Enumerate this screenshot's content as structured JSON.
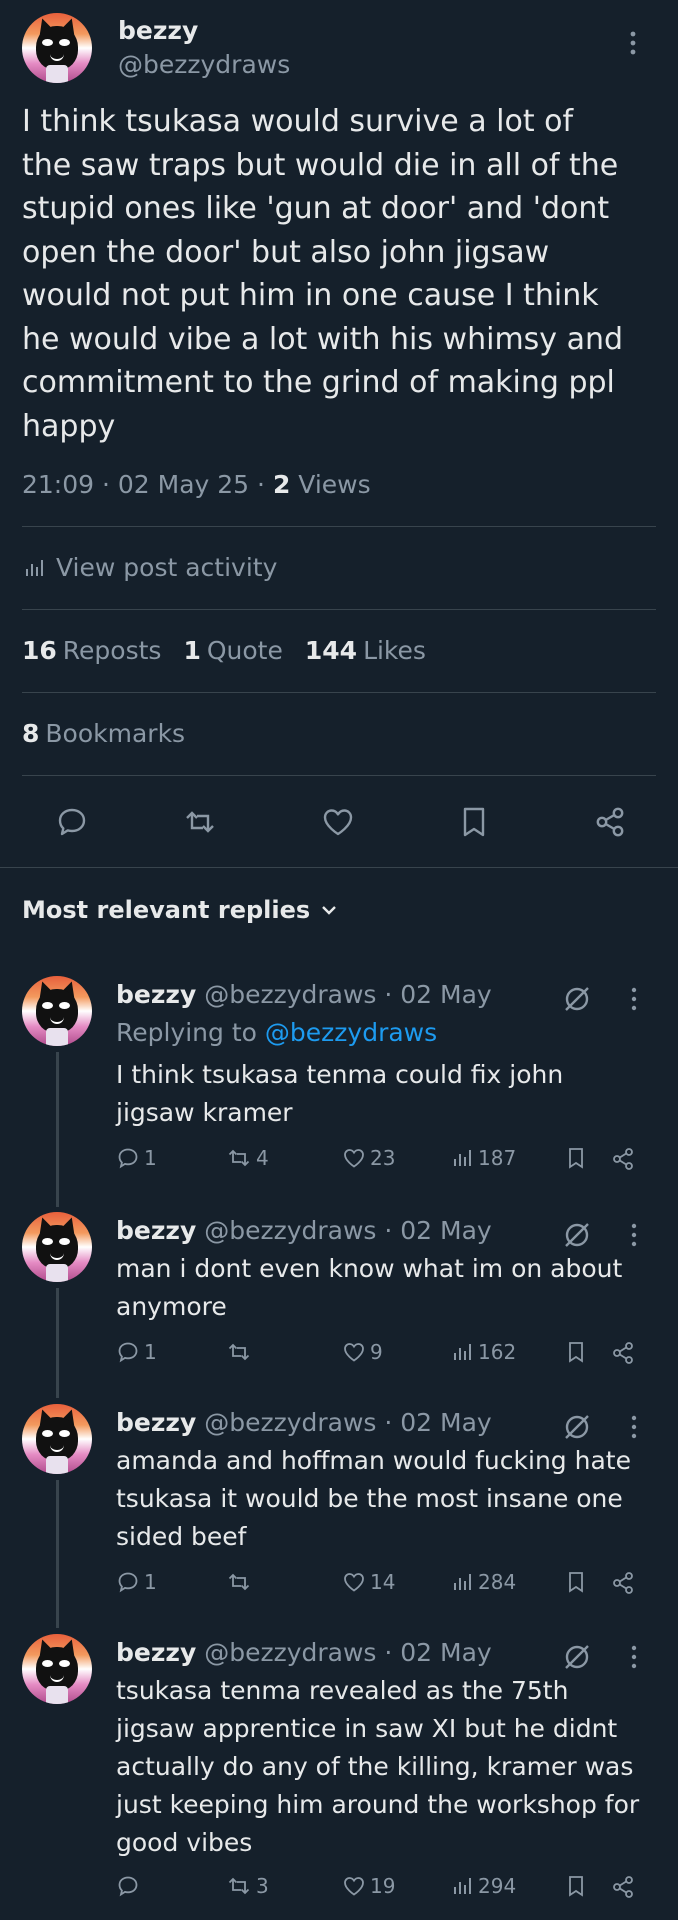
{
  "main": {
    "name": "bezzy",
    "handle": "@bezzydraws",
    "text_lines": [
      "I think tsukasa would survive a lot of",
      "the saw traps but would die in all of the",
      "stupid ones like 'gun at door' and 'dont",
      "open the door' but also john jigsaw",
      "would not put him in one cause I think",
      "he would vibe a lot with his whimsy and",
      "commitment to the grind of making ppl",
      "happy"
    ],
    "timestamp": "21:09 · 02 May 25 ·",
    "views_count": "2",
    "views_label": "Views",
    "activity_label": "View post activity",
    "reposts_count": "16",
    "reposts_label": "Reposts",
    "quotes_count": "1",
    "quotes_label": "Quote",
    "likes_count": "144",
    "likes_label": "Likes",
    "bookmarks_count": "8",
    "bookmarks_label": "Bookmarks"
  },
  "sort_label": "Most relevant replies",
  "replies": [
    {
      "name": "bezzy",
      "handle_date": "@bezzydraws · 02 May",
      "replying_prefix": "Replying to",
      "replying_to": "@bezzydraws",
      "lines": [
        "I think tsukasa tenma could fix john",
        "jigsaw kramer"
      ],
      "replies": "1",
      "reposts": "4",
      "likes": "23",
      "views": "187"
    },
    {
      "name": "bezzy",
      "handle_date": "@bezzydraws · 02 May",
      "lines": [
        "man i dont even know what im on about",
        "anymore"
      ],
      "replies": "1",
      "reposts": "",
      "likes": "9",
      "views": "162"
    },
    {
      "name": "bezzy",
      "handle_date": "@bezzydraws · 02 May",
      "lines": [
        "amanda and hoffman would fucking hate",
        "tsukasa it would be the most insane one",
        "sided beef"
      ],
      "replies": "1",
      "reposts": "",
      "likes": "14",
      "views": "284"
    },
    {
      "name": "bezzy",
      "handle_date": "@bezzydraws · 02 May",
      "lines": [
        "tsukasa tenma revealed as the 75th",
        "jigsaw apprentice in saw XI  but he didnt",
        "actually do any of the killing, kramer was",
        "just keeping him around the workshop for",
        "good vibes"
      ],
      "replies": "",
      "reposts": "3",
      "likes": "19",
      "views": "294"
    }
  ],
  "colors": {
    "background": "#15202b",
    "text": "#e7e9ea",
    "muted": "#8b98a5",
    "link": "#1d9bf0",
    "divider": "#38444d"
  }
}
